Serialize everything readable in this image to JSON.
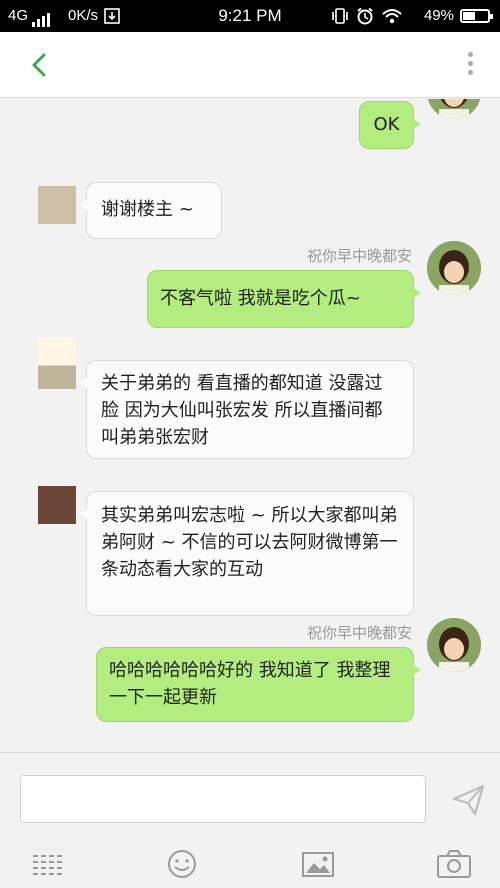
{
  "status_bar": {
    "network": "4G",
    "speed": "0K/s",
    "time": "9:21 PM",
    "battery": "49%",
    "battery_level": 0.49
  },
  "header": {
    "back_icon": "chevron-left-icon",
    "more_icon": "vertical-dots-icon"
  },
  "messages": [
    {
      "side": "out",
      "text": "OK"
    },
    {
      "side": "in",
      "text": "谢谢楼主 ~"
    },
    {
      "side": "out",
      "sender": "祝你早中晚都安",
      "text": "不客气啦 我就是吃个瓜~"
    },
    {
      "side": "in",
      "text": "关于弟弟的 看直播的都知道 没露过脸 因为大仙叫张宏发 所以直播间都叫弟弟张宏财"
    },
    {
      "side": "in",
      "text": "其实弟弟叫宏志啦 ~ 所以大家都叫弟弟阿财 ~ 不信的可以去阿财微博第一条动态看大家的互动"
    },
    {
      "side": "out",
      "sender": "祝你早中晚都安",
      "text": "哈哈哈哈哈哈好的 我知道了 我整理一下一起更新"
    }
  ],
  "input": {
    "value": "",
    "placeholder": ""
  },
  "toolbar": {
    "icons": [
      "menu-lines-icon",
      "emoji-icon",
      "image-icon",
      "camera-icon",
      "send-icon"
    ]
  },
  "colors": {
    "accent": "#3aaa4a",
    "out_bubble": "#b3ec7f",
    "in_bubble": "#fbfbfb"
  }
}
